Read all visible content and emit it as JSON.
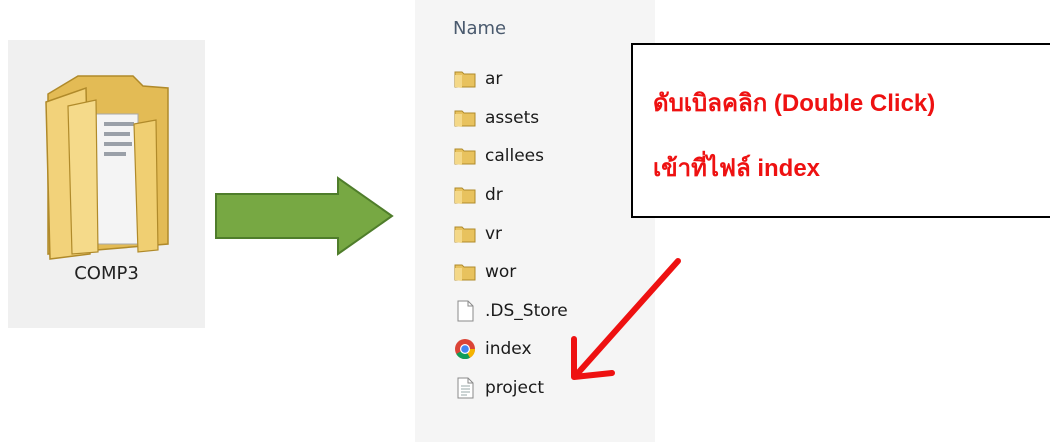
{
  "desktop_folder": {
    "label": "COMP3",
    "icon": "folder-icon"
  },
  "explorer": {
    "column_header": "Name",
    "items": [
      {
        "name": "ar",
        "icon": "folder-icon"
      },
      {
        "name": "assets",
        "icon": "folder-icon"
      },
      {
        "name": "callees",
        "icon": "folder-icon"
      },
      {
        "name": "dr",
        "icon": "folder-icon"
      },
      {
        "name": "vr",
        "icon": "folder-icon"
      },
      {
        "name": "wor",
        "icon": "folder-icon"
      },
      {
        "name": ".DS_Store",
        "icon": "blank-file-icon"
      },
      {
        "name": "index",
        "icon": "chrome-icon"
      },
      {
        "name": "project",
        "icon": "text-file-icon"
      }
    ]
  },
  "callout": {
    "line1": "ดับเบิลคลิก (Double Click)",
    "line2": "เข้าที่ไฟล์ index"
  },
  "colors": {
    "arrow_green": "#77a843",
    "callout_red": "#ee1111",
    "folder_yellow": "#f2d27a"
  }
}
